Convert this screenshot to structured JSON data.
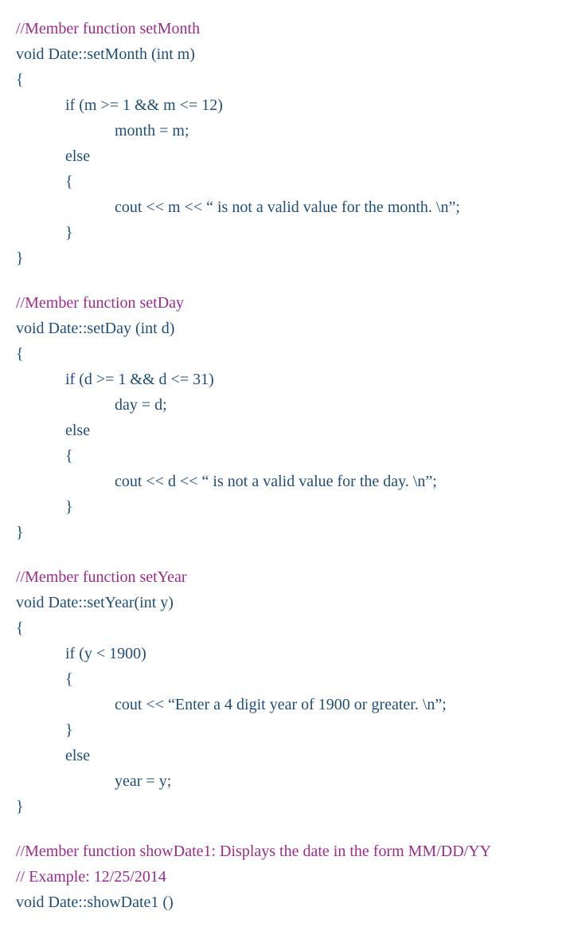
{
  "lines": {
    "l1": "//Member function setMonth",
    "l2": "void Date::setMonth (int m)",
    "l3": "{",
    "l4": "if (m >= 1 && m <= 12)",
    "l5": "month = m;",
    "l6": "else",
    "l7": "{",
    "l8": "cout << m << “ is not a valid value for the month. \\n”;",
    "l9": "}",
    "l10": "}",
    "l11": "//Member function setDay",
    "l12": "void Date::setDay (int d)",
    "l13": "{",
    "l14": "if (d >= 1 && d <= 31)",
    "l15": "day = d;",
    "l16": "else",
    "l17": "{",
    "l18": "cout << d << “ is not a valid value for the day. \\n”;",
    "l19": "}",
    "l20": "}",
    "l21": "//Member function setYear",
    "l22": "void Date::setYear(int y)",
    "l23": "{",
    "l24": "if (y < 1900)",
    "l25": "{",
    "l26": "cout << “Enter a 4 digit year of 1900 or greater. \\n”;",
    "l27": "}",
    "l28": "else",
    "l29": "year = y;",
    "l30": "}",
    "l31": "//Member function showDate1: Displays the date in the form MM/DD/YY",
    "l32": "// Example: 12/25/2014",
    "l33": "void Date::showDate1 ()"
  }
}
